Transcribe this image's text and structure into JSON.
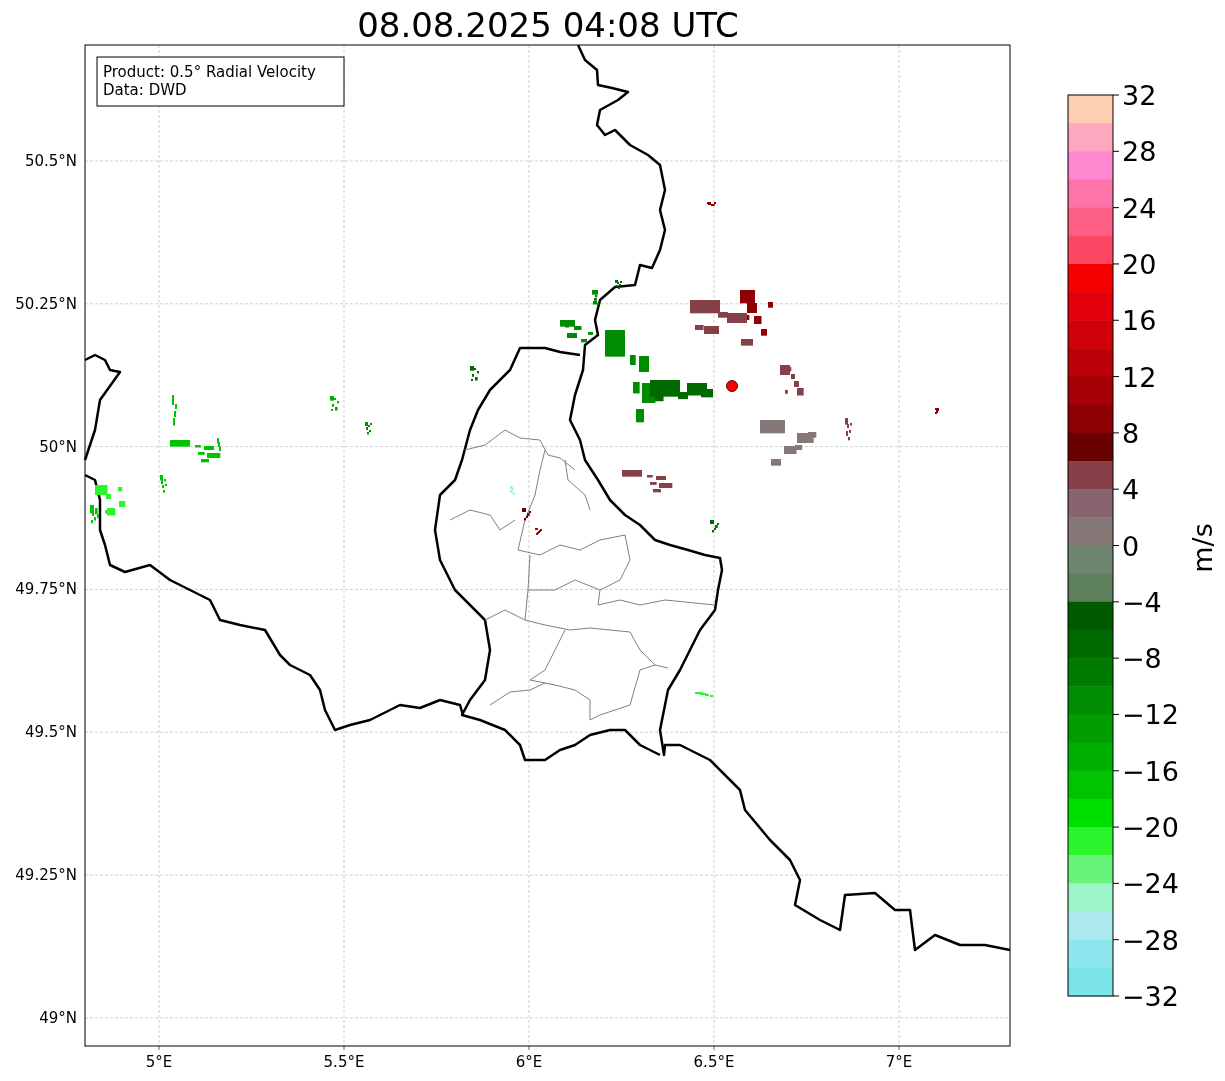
{
  "title": "08.08.2025 04:08 UTC",
  "legend_box": [
    "Product: 0.5° Radial Velocity",
    "Data: DWD"
  ],
  "x_ticks": [
    "5°E",
    "5.5°E",
    "6°E",
    "6.5°E",
    "7°E"
  ],
  "y_ticks": [
    "50.5°N",
    "50.25°N",
    "50°N",
    "49.75°N",
    "49.5°N",
    "49.25°N",
    "49°N"
  ],
  "colorbar": {
    "label": "m/s",
    "ticks": [
      "32",
      "28",
      "24",
      "20",
      "16",
      "12",
      "8",
      "4",
      "0",
      "−4",
      "−8",
      "−12",
      "−16",
      "−20",
      "−24",
      "−28",
      "−32"
    ],
    "segments": [
      {
        "color": "#fecfb0"
      },
      {
        "color": "#fea8c0"
      },
      {
        "color": "#fd88cf"
      },
      {
        "color": "#fd75a8"
      },
      {
        "color": "#fd5e85"
      },
      {
        "color": "#fb4763"
      },
      {
        "color": "#f60000"
      },
      {
        "color": "#e1000a"
      },
      {
        "color": "#d0000a"
      },
      {
        "color": "#bb0008"
      },
      {
        "color": "#a50006"
      },
      {
        "color": "#8e0004"
      },
      {
        "color": "#6a0000"
      },
      {
        "color": "#864048"
      },
      {
        "color": "#876470"
      },
      {
        "color": "#877878"
      },
      {
        "color": "#6e8670"
      },
      {
        "color": "#5d7f5a"
      },
      {
        "color": "#005a00"
      },
      {
        "color": "#006a00"
      },
      {
        "color": "#007a00"
      },
      {
        "color": "#008c00"
      },
      {
        "color": "#009c00"
      },
      {
        "color": "#00b000"
      },
      {
        "color": "#00c400"
      },
      {
        "color": "#00e000"
      },
      {
        "color": "#2df52d"
      },
      {
        "color": "#66f57a"
      },
      {
        "color": "#9cf5c8"
      },
      {
        "color": "#ade8ee"
      },
      {
        "color": "#8ee6ee"
      },
      {
        "color": "#7ae4e8"
      }
    ]
  }
}
